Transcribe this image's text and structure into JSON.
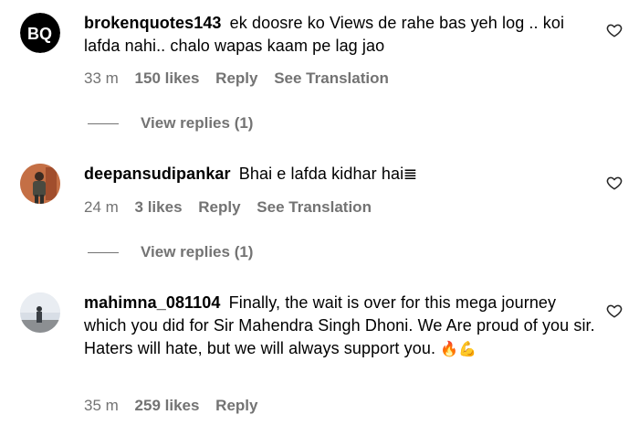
{
  "comments": [
    {
      "username": "brokenquotes143",
      "avatar_text": "BQ",
      "text": "ek doosre ko Views de rahe bas yeh log .. koi lafda nahi.. chalo wapas kaam pe lag jao",
      "time": "33 m",
      "likes": "150 likes",
      "reply_label": "Reply",
      "translation_label": "See Translation",
      "view_replies": "View replies (1)"
    },
    {
      "username": "deepansudipankar",
      "text": "Bhai e lafda kidhar hai",
      "text_emoji": "𝌆",
      "time": "24 m",
      "likes": "3 likes",
      "reply_label": "Reply",
      "translation_label": "See Translation",
      "view_replies": "View replies (1)"
    },
    {
      "username": "mahimna_081104",
      "text": "Finally, the wait is over for this mega journey which you did for Sir Mahendra Singh Dhoni. We Are proud of you sir. Haters will hate, but we will always support you.",
      "text_emoji": "🔥💪",
      "time": "35 m",
      "likes": "259 likes",
      "reply_label": "Reply"
    }
  ],
  "icons": {
    "heart": "heart-outline-icon"
  },
  "colors": {
    "text": "#000000",
    "meta": "#737373",
    "background": "#ffffff"
  }
}
